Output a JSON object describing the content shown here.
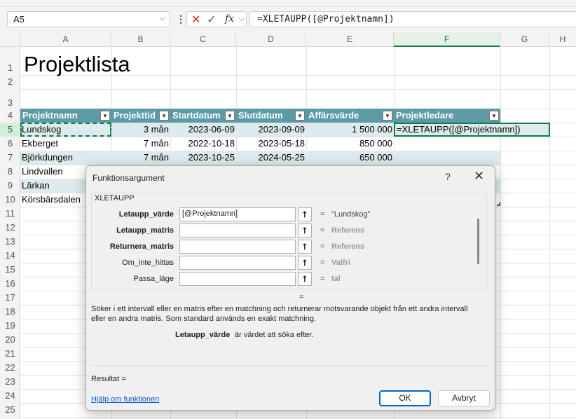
{
  "formula_bar": {
    "name_box": "A5",
    "formula": "=XLETAUPP([@Projektnamn])",
    "fx_label": "fx"
  },
  "columns": [
    "A",
    "B",
    "C",
    "D",
    "E",
    "F",
    "G",
    "H"
  ],
  "selected_column": "F",
  "rows": [
    "1",
    "2",
    "3",
    "4",
    "5",
    "6",
    "7",
    "8",
    "9",
    "10",
    "11",
    "12",
    "13",
    "14",
    "15",
    "16",
    "17",
    "18",
    "19",
    "20",
    "21",
    "22",
    "23",
    "24",
    "25"
  ],
  "sheet": {
    "title": "Projektlista",
    "table_headers": [
      "Projektnamn",
      "Projekttid",
      "Startdatum",
      "Slutdatum",
      "Affärsvärde",
      "Projektledare"
    ],
    "table_rows": [
      {
        "name": "Lundskog",
        "time": "3 mån",
        "start": "2023-06-09",
        "end": "2023-09-09",
        "value": "1 500 000"
      },
      {
        "name": "Ekberget",
        "time": "7 mån",
        "start": "2022-10-18",
        "end": "2023-05-18",
        "value": "850 000"
      },
      {
        "name": "Björkdungen",
        "time": "7 mån",
        "start": "2023-10-25",
        "end": "2024-05-25",
        "value": "650 000"
      },
      {
        "name": "Lindvallen"
      },
      {
        "name": "Lärkan"
      },
      {
        "name": "Körsbärsdalen"
      }
    ],
    "editing_formula": "=XLETAUPP([@Projektnamn])"
  },
  "dialog": {
    "title": "Funktionsargument",
    "help_glyph": "?",
    "close_glyph": "✕",
    "function_name": "XLETAUPP",
    "args": [
      {
        "label": "Letaupp_värde",
        "bold": true,
        "value": "[@Projektnamn]",
        "result": "\"Lundskog\""
      },
      {
        "label": "Letaupp_matris",
        "bold": true,
        "value": "",
        "result": "Referens"
      },
      {
        "label": "Returnera_matris",
        "bold": true,
        "value": "",
        "result": "Referens"
      },
      {
        "label": "Om_inte_hittas",
        "bold": false,
        "value": "",
        "result": "Valfri"
      },
      {
        "label": "Passa_läge",
        "bold": false,
        "value": "",
        "result": "tal"
      }
    ],
    "equals": "=",
    "description": "Söker i ett intervall eller en matris efter en matchning och returnerar motsvarande objekt från ett andra intervall eller en andra matris. Som standard används en exakt matchning.",
    "arg_desc_name": "Letaupp_värde",
    "arg_desc_text": "är värdet att söka efter.",
    "result_label": "Resultat =",
    "help_link": "Hjälp om funktionen",
    "ok_label": "OK",
    "cancel_label": "Avbryt"
  }
}
